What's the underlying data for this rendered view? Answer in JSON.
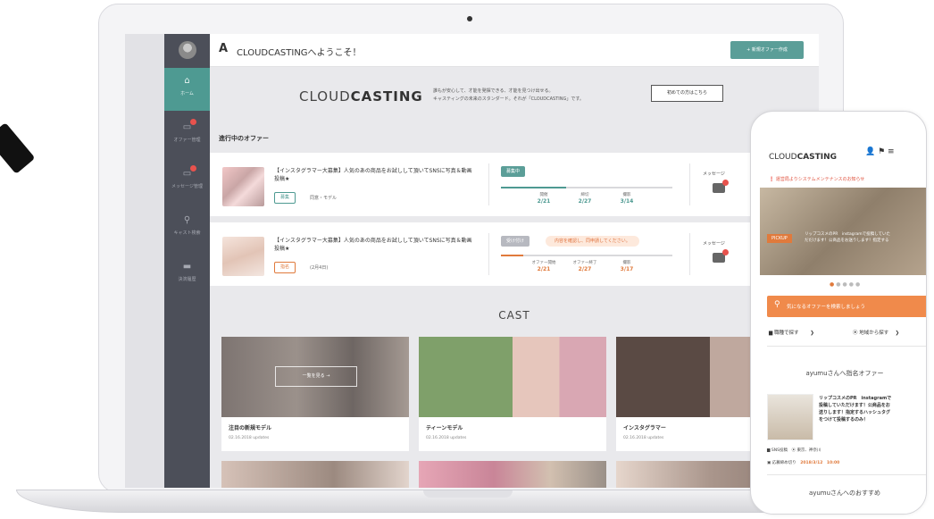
{
  "header": {
    "logo": "A",
    "title": "CLOUDCASTINGへようこそ！",
    "new_offer_button": "+ 新規オファー作成"
  },
  "sidebar": {
    "items": [
      {
        "icon": "home-icon",
        "label": "ホーム",
        "active": true
      },
      {
        "icon": "offer-icon",
        "label": "オファー管理",
        "badge": true
      },
      {
        "icon": "message-icon",
        "label": "メッセージ管理",
        "badge": true
      },
      {
        "icon": "search-icon",
        "label": "キャスト検索"
      },
      {
        "icon": "payment-icon",
        "label": "決済履歴"
      }
    ]
  },
  "banner": {
    "logo_light": "CLOUD",
    "logo_bold": "CASTING",
    "text_line1": "誰もが安心して、才能を発揮できる、才能を見つけ出せる。",
    "text_line2": "キャスティングの未来のスタンダード。それが「CLOUDCASTING」です。",
    "first_button": "初めての方はこちら"
  },
  "offers_section": {
    "title": "進行中のオファー",
    "message_label": "メッセージ",
    "offers": [
      {
        "title": "【インスタグラマー大募集】人気のあの商品をお試しして頂いてSNSに写真＆動画投稿★",
        "tag": "募集",
        "sub": "同意・モデル",
        "status": "募集中",
        "status_color": "#5b9e98",
        "progress": 0.38,
        "stages": [
          {
            "label": "開催",
            "date": "2/21"
          },
          {
            "label": "締切",
            "date": "2/27"
          },
          {
            "label": "撮影",
            "date": "3/14"
          }
        ]
      },
      {
        "title": "【インスタグラマー大募集】人気のあの商品をお試しして頂いてSNSに写真＆動画投稿★",
        "tag": "指名",
        "sub": "(2月4日)",
        "status": "受け付け",
        "status_color": "#b7b9c0",
        "warning": "内容を確認し、同申請してください。",
        "progress": 0.13,
        "stages": [
          {
            "label": "オファー開始",
            "date": "2/21"
          },
          {
            "label": "オファー終了",
            "date": "2/27"
          },
          {
            "label": "撮影",
            "date": "3/17"
          }
        ]
      }
    ]
  },
  "cast": {
    "title": "CAST",
    "see_all": "一覧を見る →",
    "cards": [
      {
        "label": "注目の新規モデル",
        "date": "02.16.2018 updates"
      },
      {
        "label": "ティーンモデル",
        "date": "02.16.2018 updates"
      },
      {
        "label": "インスタグラマー",
        "date": "02.16.2018 updates"
      }
    ]
  },
  "phone": {
    "logo_light": "CLOUD",
    "logo_bold": "CASTING",
    "icons": "👤 ⚑ ≡",
    "alert": "❗ 運営局よりシステムメンテナンスのお知らせ",
    "pickup": "PICKUP",
    "hero_text_line1": "リップコスメのPR　instagramで投稿していた",
    "hero_text_line2": "だだけます！公商品をお送りします！指定する",
    "search_placeholder": "気になるオファーを検索しましょう",
    "filter_genre": "職種で探す",
    "filter_area": "地域から探す",
    "offer_section": "ayumuさんへ指名オファー",
    "offer_text_line1": "リップコスメのPR　instagramで",
    "offer_text_line2": "投稿していただけます！公商品をお",
    "offer_text_line3": "送りします！指定するハッシュタグ",
    "offer_text_line4": "をつけて投稿するのみ！",
    "meta1_a": "SNS投稿",
    "meta1_b": "東京、神奈川",
    "meta2_a": "応募締め切り",
    "meta2_b": "2018/3/12　10:00",
    "recommend_section": "ayumuさんへのおすすめ"
  }
}
